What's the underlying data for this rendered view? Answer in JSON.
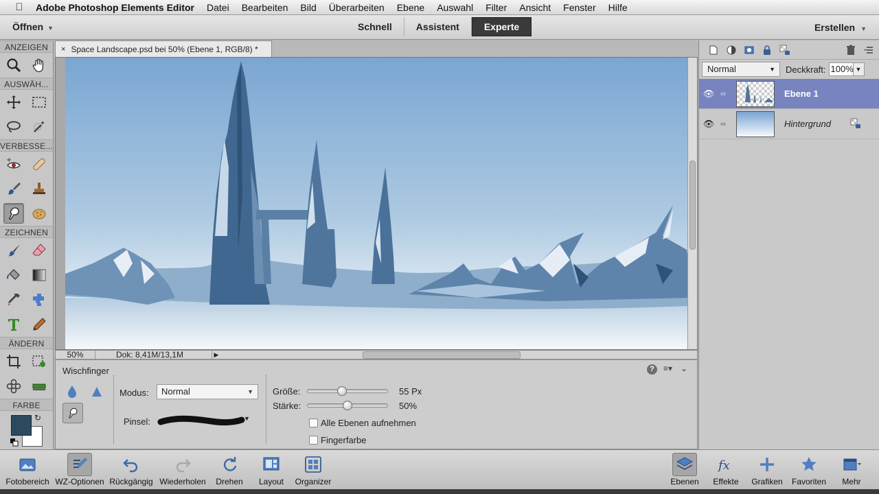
{
  "menubar": {
    "apple": "",
    "app": "Adobe Photoshop Elements Editor",
    "items": [
      "Datei",
      "Bearbeiten",
      "Bild",
      "Überarbeiten",
      "Ebene",
      "Auswahl",
      "Filter",
      "Ansicht",
      "Fenster",
      "Hilfe"
    ]
  },
  "topbar": {
    "open_label": "Öffnen",
    "modes": [
      "Schnell",
      "Assistent",
      "Experte"
    ],
    "active_mode": "Experte",
    "create_label": "Erstellen"
  },
  "toolbox": {
    "sections": [
      "ANZEIGEN",
      "AUSWÄH...",
      "VERBESSE...",
      "ZEICHNEN",
      "ÄNDERN",
      "FARBE"
    ],
    "colors": {
      "foreground": "#2b4a5f",
      "background": "#ffffff"
    }
  },
  "document": {
    "tab_title": "Space Landscape.psd bei 50% (Ebene 1, RGB/8) *",
    "zoom": "50%",
    "doc_size": "Dok: 8,41M/13,1M"
  },
  "tool_options": {
    "tool_name": "Wischfinger",
    "mode_label": "Modus:",
    "mode_value": "Normal",
    "brush_label": "Pinsel:",
    "size_label": "Größe:",
    "size_value": "55 Px",
    "size_fraction": 0.43,
    "strength_label": "Stärke:",
    "strength_value": "50%",
    "strength_fraction": 0.5,
    "sample_all_label": "Alle Ebenen aufnehmen",
    "sample_all_checked": false,
    "finger_paint_label": "Fingerfarbe",
    "finger_paint_checked": false
  },
  "layers": {
    "blend_mode": "Normal",
    "opacity_label": "Deckkraft:",
    "opacity_value": "100%",
    "items": [
      {
        "name": "Ebene 1",
        "selected": true
      },
      {
        "name": "Hintergrund",
        "selected": false,
        "locked": true
      }
    ],
    "selected_color": "#7784bf"
  },
  "bottombar": {
    "left": [
      "Fotobereich",
      "WZ-Optionen",
      "Rückgängig",
      "Wiederholen",
      "Drehen",
      "Layout",
      "Organizer"
    ],
    "right": [
      "Ebenen",
      "Effekte",
      "Grafiken",
      "Favoriten",
      "Mehr"
    ]
  }
}
